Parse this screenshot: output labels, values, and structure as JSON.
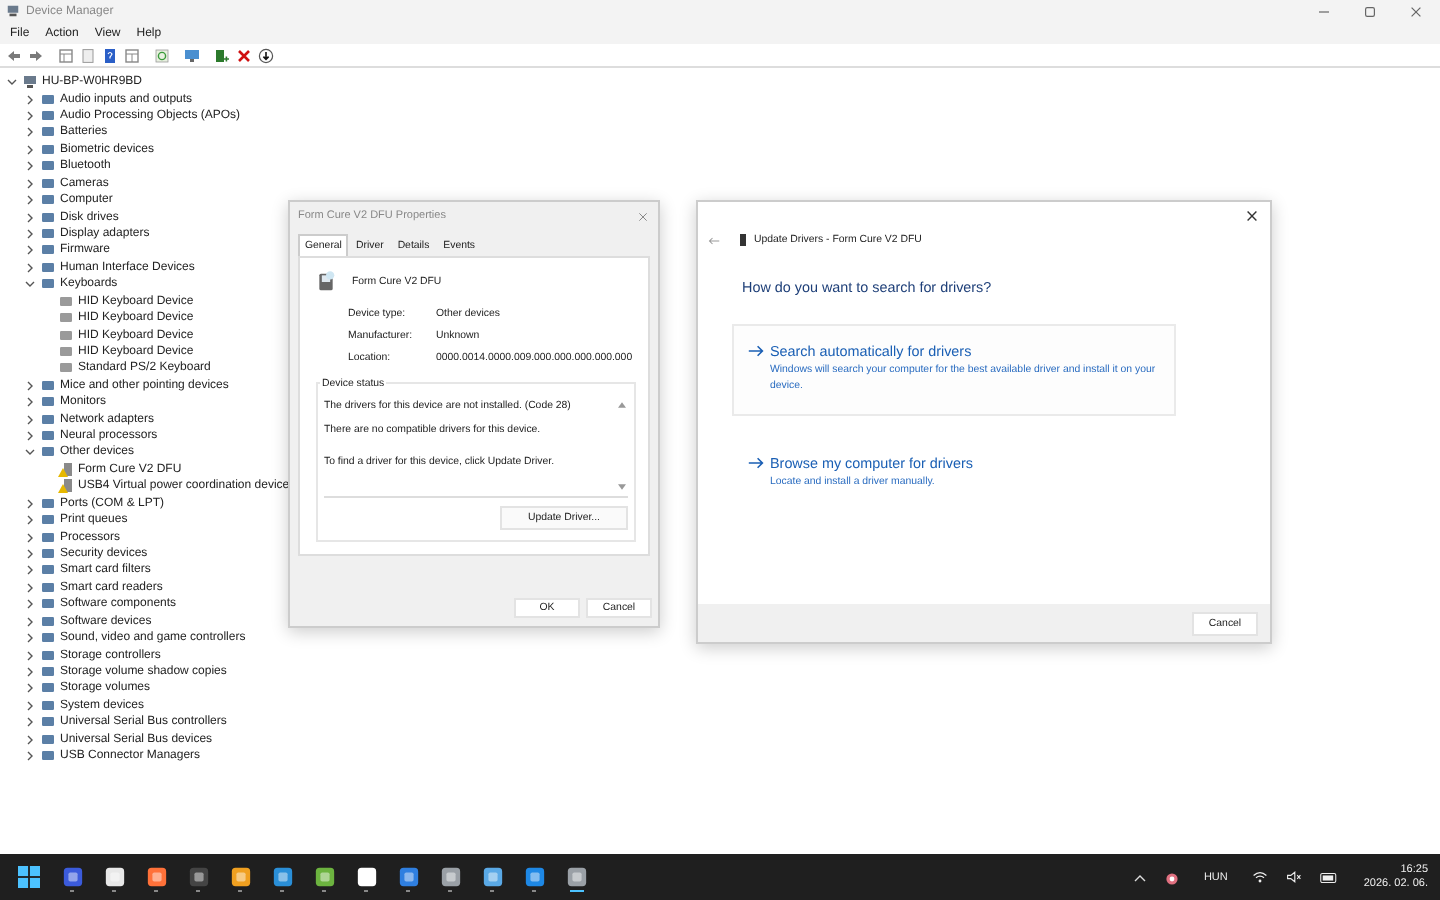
{
  "window": {
    "title": "Device Manager"
  },
  "menu": [
    "File",
    "Action",
    "View",
    "Help"
  ],
  "tree": {
    "root": {
      "label": "HU-BP-W0HR9BD",
      "expanded": true,
      "children": [
        {
          "label": "Audio inputs and outputs",
          "expanded": false
        },
        {
          "label": "Audio Processing Objects (APOs)",
          "expanded": false
        },
        {
          "label": "Batteries",
          "expanded": false
        },
        {
          "label": "Biometric devices",
          "expanded": false
        },
        {
          "label": "Bluetooth",
          "expanded": false
        },
        {
          "label": "Cameras",
          "expanded": false
        },
        {
          "label": "Computer",
          "expanded": false
        },
        {
          "label": "Disk drives",
          "expanded": false
        },
        {
          "label": "Display adapters",
          "expanded": false
        },
        {
          "label": "Firmware",
          "expanded": false
        },
        {
          "label": "Human Interface Devices",
          "expanded": false
        },
        {
          "label": "Keyboards",
          "expanded": true,
          "children": [
            {
              "label": "HID Keyboard Device"
            },
            {
              "label": "HID Keyboard Device"
            },
            {
              "label": "HID Keyboard Device"
            },
            {
              "label": "HID Keyboard Device"
            },
            {
              "label": "Standard PS/2 Keyboard"
            }
          ]
        },
        {
          "label": "Mice and other pointing devices",
          "expanded": false
        },
        {
          "label": "Monitors",
          "expanded": false
        },
        {
          "label": "Network adapters",
          "expanded": false
        },
        {
          "label": "Neural processors",
          "expanded": false
        },
        {
          "label": "Other devices",
          "expanded": true,
          "children": [
            {
              "label": "Form Cure V2 DFU",
              "warning": true
            },
            {
              "label": "USB4 Virtual power coordination device",
              "warning": true
            }
          ]
        },
        {
          "label": "Ports (COM & LPT)",
          "expanded": false
        },
        {
          "label": "Print queues",
          "expanded": false
        },
        {
          "label": "Processors",
          "expanded": false
        },
        {
          "label": "Security devices",
          "expanded": false
        },
        {
          "label": "Smart card filters",
          "expanded": false
        },
        {
          "label": "Smart card readers",
          "expanded": false
        },
        {
          "label": "Software components",
          "expanded": false
        },
        {
          "label": "Software devices",
          "expanded": false
        },
        {
          "label": "Sound, video and game controllers",
          "expanded": false
        },
        {
          "label": "Storage controllers",
          "expanded": false
        },
        {
          "label": "Storage volume shadow copies",
          "expanded": false
        },
        {
          "label": "Storage volumes",
          "expanded": false
        },
        {
          "label": "System devices",
          "expanded": false
        },
        {
          "label": "Universal Serial Bus controllers",
          "expanded": false
        },
        {
          "label": "Universal Serial Bus devices",
          "expanded": false
        },
        {
          "label": "USB Connector Managers",
          "expanded": false
        }
      ]
    }
  },
  "properties_dialog": {
    "title": "Form Cure V2 DFU Properties",
    "tabs": [
      {
        "label": "General",
        "selected": true
      },
      {
        "label": "Driver",
        "selected": false
      },
      {
        "label": "Details",
        "selected": false
      },
      {
        "label": "Events",
        "selected": false
      }
    ],
    "device_name": "Form Cure V2 DFU",
    "fields": [
      {
        "label": "Device type:",
        "value": "Other devices"
      },
      {
        "label": "Manufacturer:",
        "value": "Unknown"
      },
      {
        "label": "Location:",
        "value": "0000.0014.0000.009.000.000.000.000.000"
      }
    ],
    "status_title": "Device status",
    "status_lines": [
      "The drivers for this device are not installed. (Code 28)",
      "There are no compatible drivers for this device.",
      "To find a driver for this device, click Update Driver."
    ],
    "update_button": "Update Driver...",
    "buttons": [
      "OK",
      "Cancel"
    ]
  },
  "update_dialog": {
    "title": "Update Drivers - Form Cure V2 DFU",
    "heading": "How do you want to search for drivers?",
    "options": [
      {
        "title": "Search automatically for drivers",
        "description": "Windows will search your computer for the best available driver and install it on your device.",
        "focused": true
      },
      {
        "title": "Browse my computer for drivers",
        "description": "Locate and install a driver manually.",
        "focused": false
      }
    ],
    "cancel": "Cancel"
  },
  "taskbar": {
    "apps": [
      {
        "active": false
      },
      {
        "active": false
      },
      {
        "active": false
      },
      {
        "active": false
      },
      {
        "active": false
      },
      {
        "active": false
      },
      {
        "active": false
      },
      {
        "active": false
      },
      {
        "active": false
      },
      {
        "active": false
      },
      {
        "active": false
      },
      {
        "active": false
      },
      {
        "active": true
      }
    ],
    "language": "HUN",
    "time": "16:25",
    "date": "2026. 02. 06."
  }
}
